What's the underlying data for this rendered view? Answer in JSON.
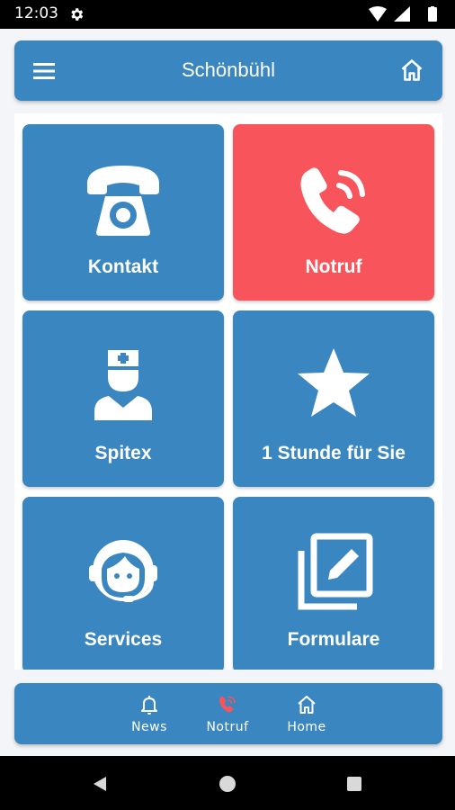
{
  "status": {
    "time": "12:03"
  },
  "header": {
    "title": "Schönbühl",
    "menu_icon": "menu-icon",
    "home_icon": "home-icon"
  },
  "tiles": [
    {
      "label": "Kontakt",
      "icon": "telephone-icon"
    },
    {
      "label": "Notruf",
      "icon": "phone-ringing-icon",
      "color": "#f7545b"
    },
    {
      "label": "Spitex",
      "icon": "nurse-icon"
    },
    {
      "label": "1 Stunde für Sie",
      "icon": "star-icon"
    },
    {
      "label": "Services",
      "icon": "headset-agent-icon"
    },
    {
      "label": "Formulare",
      "icon": "edit-form-icon"
    }
  ],
  "bottom_nav": [
    {
      "label": "News",
      "icon": "bell-icon"
    },
    {
      "label": "Notruf",
      "icon": "phone-ringing-icon",
      "active": true
    },
    {
      "label": "Home",
      "icon": "home-icon"
    }
  ],
  "colors": {
    "primary": "#3a86c0",
    "emergency": "#f7545b",
    "background": "#f4f5f8"
  }
}
